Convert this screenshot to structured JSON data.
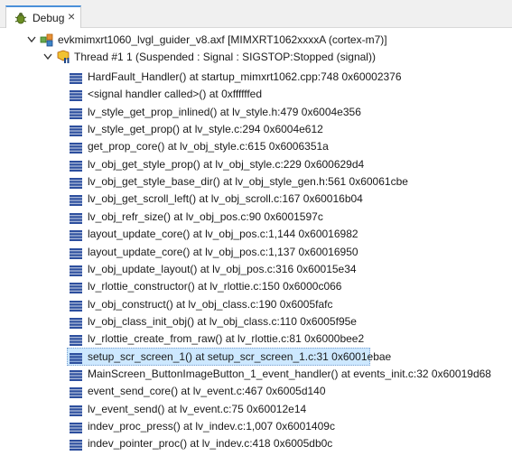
{
  "tab": {
    "label": "Debug",
    "close": "×"
  },
  "tree": {
    "process": {
      "label": "evkmimxrt1060_lvgl_guider_v8.axf [MIMXRT1062xxxxA (cortex-m7)]"
    },
    "thread": {
      "label": "Thread #1 1 (Suspended : Signal : SIGSTOP:Stopped (signal))"
    },
    "frames": [
      {
        "label": "HardFault_Handler() at startup_mimxrt1062.cpp:748 0x60002376"
      },
      {
        "label": "<signal handler called>() at 0xffffffed"
      },
      {
        "label": "lv_style_get_prop_inlined() at lv_style.h:479 0x6004e356"
      },
      {
        "label": "lv_style_get_prop() at lv_style.c:294 0x6004e612"
      },
      {
        "label": "get_prop_core() at lv_obj_style.c:615 0x6006351a"
      },
      {
        "label": "lv_obj_get_style_prop() at lv_obj_style.c:229 0x600629d4"
      },
      {
        "label": "lv_obj_get_style_base_dir() at lv_obj_style_gen.h:561 0x60061cbe"
      },
      {
        "label": "lv_obj_get_scroll_left() at lv_obj_scroll.c:167 0x60016b04"
      },
      {
        "label": "lv_obj_refr_size() at lv_obj_pos.c:90 0x6001597c"
      },
      {
        "label": "layout_update_core() at lv_obj_pos.c:1,144 0x60016982"
      },
      {
        "label": "layout_update_core() at lv_obj_pos.c:1,137 0x60016950"
      },
      {
        "label": "lv_obj_update_layout() at lv_obj_pos.c:316 0x60015e34"
      },
      {
        "label": "lv_rlottie_constructor() at lv_rlottie.c:150 0x6000c066"
      },
      {
        "label": "lv_obj_construct() at lv_obj_class.c:190 0x6005fafc"
      },
      {
        "label": "lv_obj_class_init_obj() at lv_obj_class.c:110 0x6005f95e"
      },
      {
        "label": "lv_rlottie_create_from_raw() at lv_rlottie.c:81 0x6000bee2"
      },
      {
        "label": "setup_scr_screen_1() at setup_scr_screen_1.c:31 0x6001ebae",
        "selected": true
      },
      {
        "label": "MainScreen_ButtonImageButton_1_event_handler() at events_init.c:32 0x60019d68"
      },
      {
        "label": "event_send_core() at lv_event.c:467 0x6005d140"
      },
      {
        "label": "lv_event_send() at lv_event.c:75 0x60012e14"
      },
      {
        "label": "indev_proc_press() at lv_indev.c:1,007 0x6001409c"
      },
      {
        "label": "indev_pointer_proc() at lv_indev.c:418 0x6005db0c"
      }
    ]
  },
  "icons": {
    "tab": "debug-bug-icon",
    "process": "process-icon",
    "thread": "thread-suspended-icon",
    "frame": "stack-frame-icon",
    "twisty": "chevron-down-icon"
  },
  "colors": {
    "frame_icon": "#2d4f9e",
    "selection": "#cde8ff",
    "tab_accent": "#4a90d9"
  }
}
